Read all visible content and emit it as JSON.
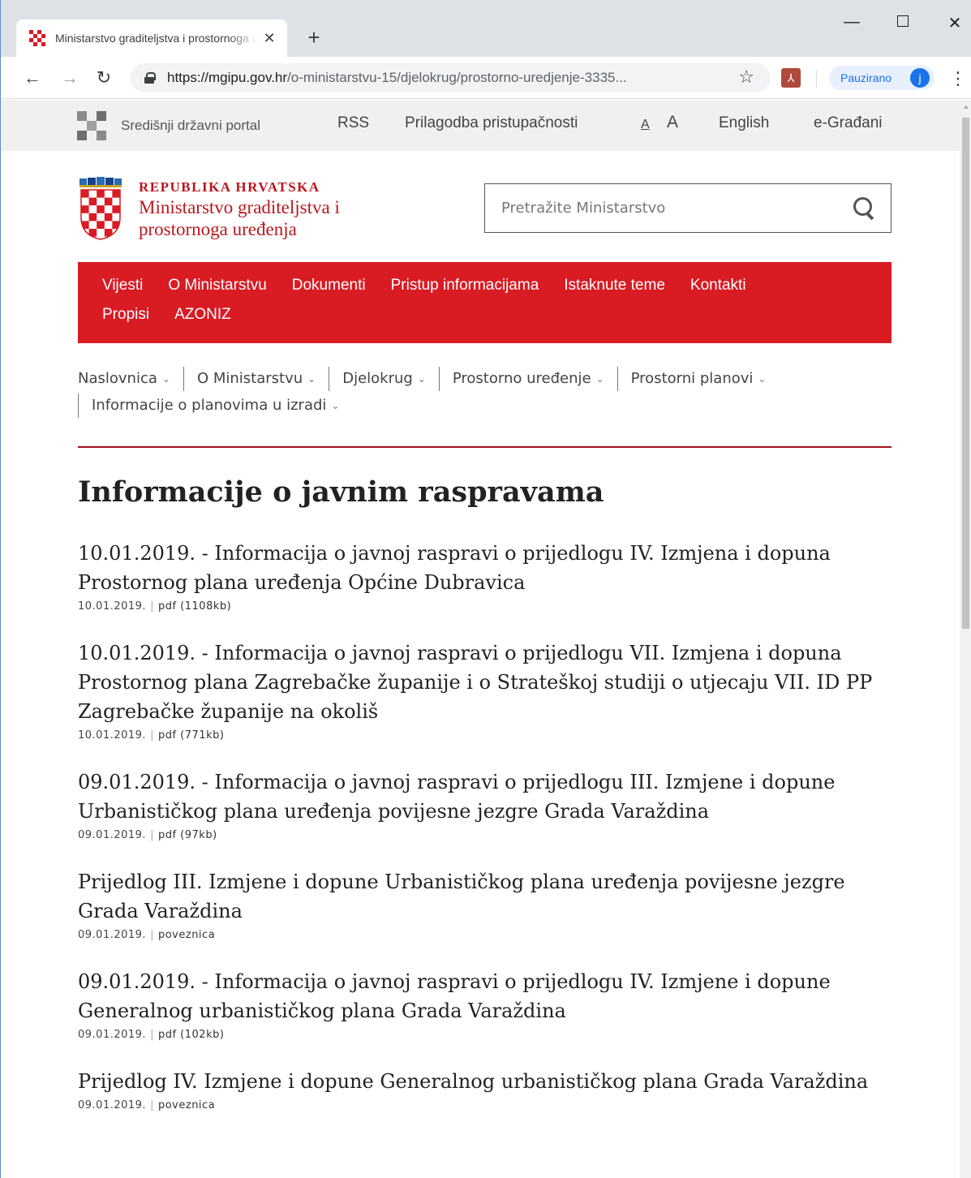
{
  "browser": {
    "tab_title": "Ministarstvo graditeljstva i prostornoga uređenja",
    "tab_close": "✕",
    "new_tab": "+",
    "url_host": "https://mgipu.gov.hr",
    "url_path": "/o-ministarstvu-15/djelokrug/prostorno-uredjenje-3335...",
    "profile_label": "Pauzirano",
    "profile_initial": "j",
    "ext_icon": "pdf-icon"
  },
  "utility_bar": {
    "portal": "Središnji državni portal",
    "rss": "RSS",
    "accessibility": "Prilagodba pristupačnosti",
    "font_small": "A",
    "font_large": "A",
    "english": "English",
    "egradani": "e-Građani"
  },
  "brand": {
    "country": "REPUBLIKA HRVATSKA",
    "ministry": "Ministarstvo graditeljstva i prostornoga uređenja",
    "color": "#b8181e"
  },
  "search": {
    "placeholder": "Pretražite Ministarstvo"
  },
  "main_nav": {
    "color": "#d91b23",
    "items": [
      "Vijesti",
      "O Ministarstvu",
      "Dokumenti",
      "Pristup informacijama",
      "Istaknute teme",
      "Kontakti",
      "Propisi",
      "AZONIZ"
    ]
  },
  "breadcrumb": [
    "Naslovnica",
    "O Ministarstvu",
    "Djelokrug",
    "Prostorno uređenje",
    "Prostorni planovi",
    "Informacije o planovima u izradi"
  ],
  "page": {
    "title": "Informacije o javnim raspravama"
  },
  "items": [
    {
      "title": "10.01.2019. - Informacija o javnoj raspravi o prijedlogu IV. Izmjena i dopuna Prostornog plana uređenja Općine Dubravica",
      "date": "10.01.2019.",
      "link": "pdf (1108kb)"
    },
    {
      "title": "10.01.2019. - Informacija o javnoj raspravi o prijedlogu VII. Izmjena i dopuna Prostornog plana Zagrebačke županije i o Strateškoj studiji o utjecaju VII. ID PP Zagrebačke županije na okoliš",
      "date": "10.01.2019.",
      "link": "pdf (771kb)"
    },
    {
      "title": "09.01.2019. - Informacija o javnoj raspravi o prijedlogu III. Izmjene i dopune Urbanističkog plana uređenja povijesne jezgre Grada Varaždina",
      "date": "09.01.2019.",
      "link": "pdf (97kb)"
    },
    {
      "title": "Prijedlog III. Izmjene i dopune Urbanističkog plana uređenja povijesne jezgre Grada Varaždina",
      "date": "09.01.2019.",
      "link": "poveznica"
    },
    {
      "title": "09.01.2019. - Informacija o javnoj raspravi o prijedlogu IV. Izmjene i dopune Generalnog urbanističkog plana Grada Varaždina",
      "date": "09.01.2019.",
      "link": "pdf (102kb)"
    },
    {
      "title": "Prijedlog IV. Izmjene i dopune Generalnog urbanističkog plana Grada Varaždina",
      "date": "09.01.2019.",
      "link": "poveznica"
    }
  ]
}
